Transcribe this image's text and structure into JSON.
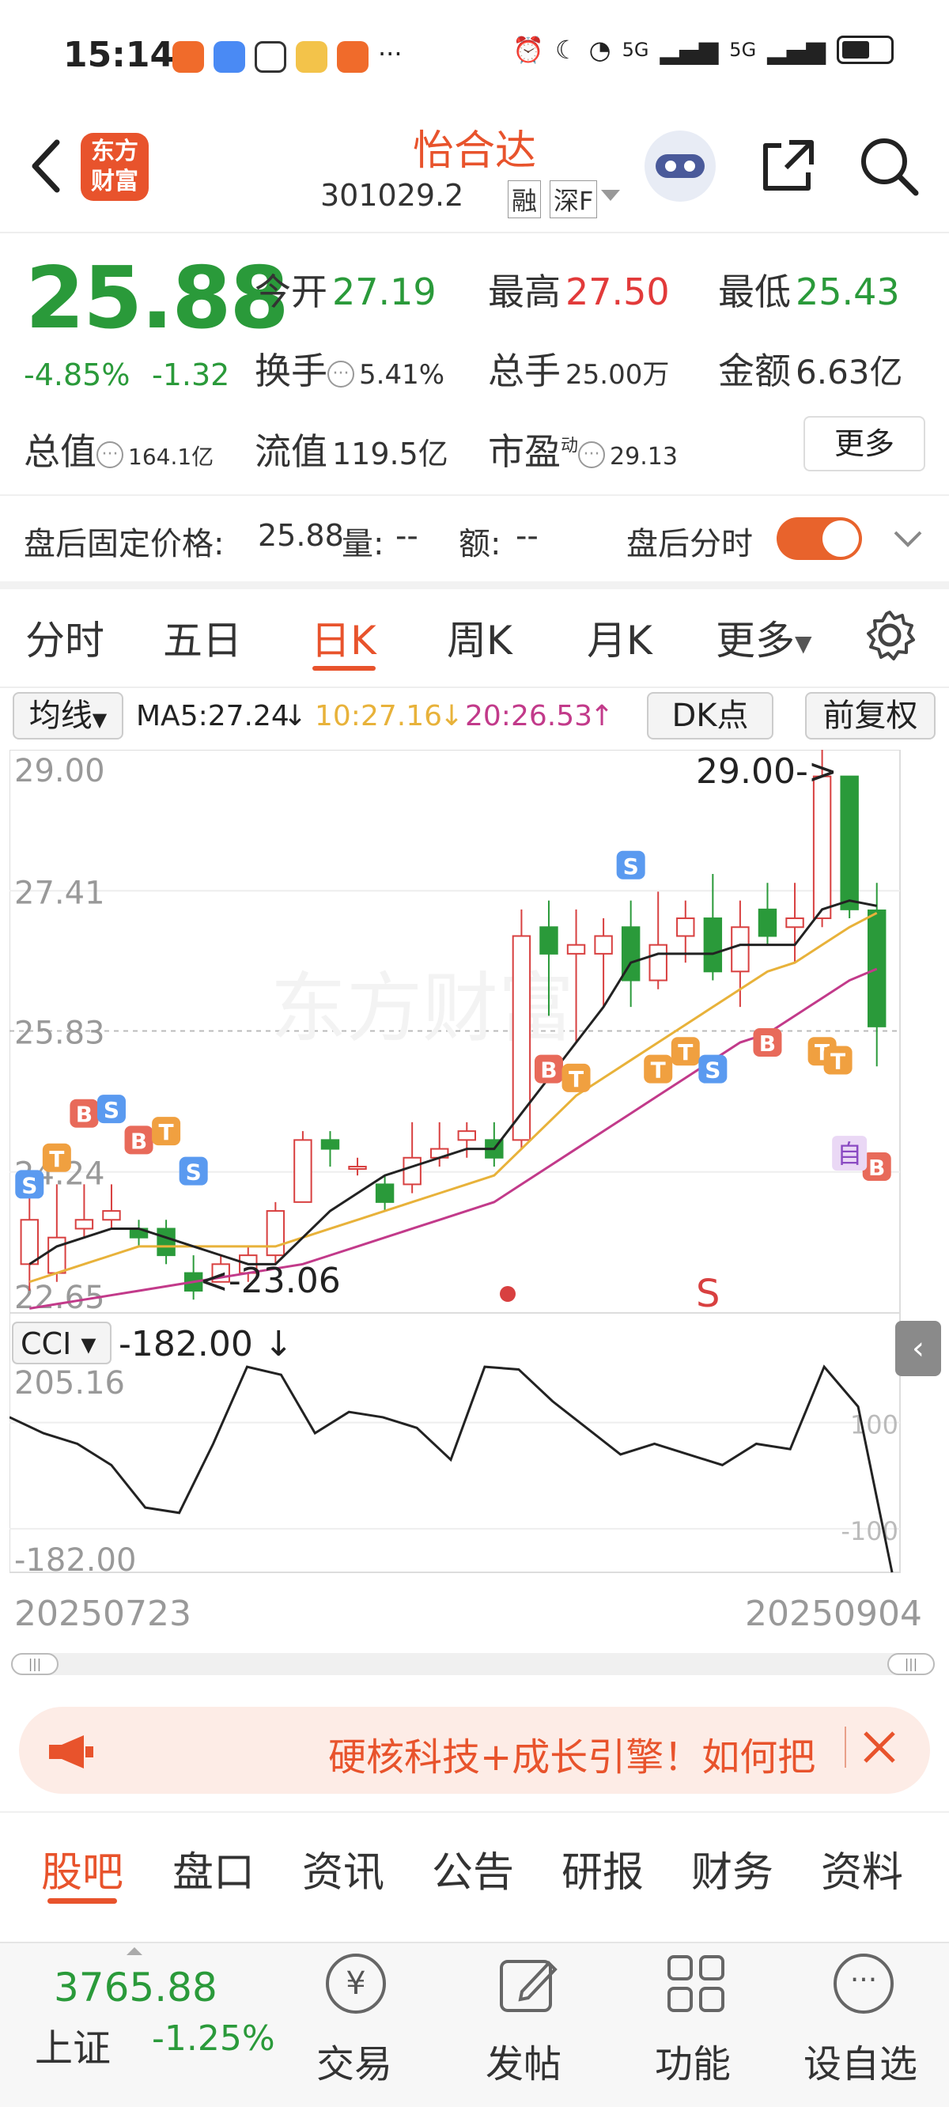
{
  "status_bar": {
    "time": "15:14",
    "signal1": "5G",
    "signal2": "5G"
  },
  "header": {
    "brand_line1": "东方",
    "brand_line2": "财富",
    "title": "怡合达",
    "code": "301029.2",
    "tag1": "融",
    "tag2": "深F"
  },
  "quote": {
    "price": "25.88",
    "change_pct": "-4.85%",
    "change": "-1.32",
    "open_label": "今开",
    "open": "27.19",
    "high_label": "最高",
    "high": "27.50",
    "low_label": "最低",
    "low": "25.43",
    "turnover_label": "换手",
    "turnover": "5.41%",
    "volume_label": "总手",
    "volume": "25.00万",
    "amount_label": "金额",
    "amount": "6.63亿",
    "mktcap_label": "总值",
    "mktcap": "164.1亿",
    "float_label": "流值",
    "float": "119.5亿",
    "pe_label": "市盈",
    "pe_sup": "动",
    "pe": "29.13",
    "more": "更多"
  },
  "after_hours": {
    "label": "盘后固定价格:",
    "price": "25.88",
    "vol_label": "量:",
    "vol": "--",
    "amt_label": "额:",
    "amt": "--",
    "toggle_label": "盘后分时"
  },
  "period_tabs": [
    {
      "label": "分时"
    },
    {
      "label": "五日"
    },
    {
      "label": "日K"
    },
    {
      "label": "周K"
    },
    {
      "label": "月K"
    },
    {
      "label": "更多"
    }
  ],
  "ma_bar": {
    "selector": "均线",
    "ma5": "MA5:27.24",
    "ma10": "10:27.16",
    "ma20": "20:26.53",
    "dk": "DK点",
    "adjust": "前复权"
  },
  "kline": {
    "y_labels": [
      "29.00",
      "27.41",
      "25.83",
      "24.24",
      "22.65"
    ],
    "max_note": "29.00->",
    "min_note": "<-23.06",
    "s_marker": "S",
    "signals": [
      "S",
      "T",
      "B",
      "S",
      "B",
      "T",
      "S",
      "B",
      "T",
      "S",
      "T",
      "T",
      "S",
      "B",
      "T",
      "T",
      "B"
    ],
    "self_tag": "自",
    "watermark": "东方财富"
  },
  "cci": {
    "selector": "CCI",
    "value": "-182.00",
    "y_labels": [
      "205.16",
      "-182.00"
    ],
    "ref_labels": [
      "100",
      "-100"
    ]
  },
  "date_range": {
    "start": "20250723",
    "end": "20250904"
  },
  "ad_banner": {
    "text": "硬核科技+成长引擎！如何把"
  },
  "bottom_tabs": [
    {
      "label": "股吧"
    },
    {
      "label": "盘口"
    },
    {
      "label": "资讯"
    },
    {
      "label": "公告"
    },
    {
      "label": "研报"
    },
    {
      "label": "财务"
    },
    {
      "label": "资料"
    }
  ],
  "index": {
    "value": "3765.88",
    "name": "上证",
    "change": "-1.25%"
  },
  "nav": [
    {
      "label": "交易"
    },
    {
      "label": "发帖"
    },
    {
      "label": "功能"
    },
    {
      "label": "设自选"
    }
  ],
  "chart_data": {
    "type": "candlestick",
    "x_range": [
      "20250723",
      "20250904"
    ],
    "ylim": [
      22.65,
      29.0
    ],
    "candles": [
      {
        "o": 23.2,
        "c": 23.7,
        "h": 24.0,
        "l": 22.9
      },
      {
        "o": 23.1,
        "c": 23.5,
        "h": 24.1,
        "l": 23.0
      },
      {
        "o": 23.6,
        "c": 23.7,
        "h": 24.1,
        "l": 23.5
      },
      {
        "o": 23.7,
        "c": 23.8,
        "h": 24.1,
        "l": 23.6
      },
      {
        "o": 23.6,
        "c": 23.5,
        "h": 23.7,
        "l": 23.4
      },
      {
        "o": 23.6,
        "c": 23.3,
        "h": 23.7,
        "l": 23.2
      },
      {
        "o": 23.1,
        "c": 22.9,
        "h": 23.3,
        "l": 22.8
      },
      {
        "o": 23.0,
        "c": 23.2,
        "h": 23.3,
        "l": 23.0
      },
      {
        "o": 23.1,
        "c": 23.3,
        "h": 23.4,
        "l": 23.0
      },
      {
        "o": 23.3,
        "c": 23.8,
        "h": 23.9,
        "l": 23.2
      },
      {
        "o": 23.9,
        "c": 24.6,
        "h": 24.7,
        "l": 23.9
      },
      {
        "o": 24.6,
        "c": 24.5,
        "h": 24.7,
        "l": 24.3
      },
      {
        "o": 24.3,
        "c": 24.3,
        "h": 24.4,
        "l": 24.2
      },
      {
        "o": 24.1,
        "c": 23.9,
        "h": 24.2,
        "l": 23.8
      },
      {
        "o": 24.1,
        "c": 24.4,
        "h": 24.8,
        "l": 24.0
      },
      {
        "o": 24.4,
        "c": 24.5,
        "h": 24.8,
        "l": 24.3
      },
      {
        "o": 24.6,
        "c": 24.7,
        "h": 24.8,
        "l": 24.4
      },
      {
        "o": 24.6,
        "c": 24.4,
        "h": 24.8,
        "l": 24.3
      },
      {
        "o": 24.6,
        "c": 26.9,
        "h": 27.2,
        "l": 24.5
      },
      {
        "o": 27.0,
        "c": 26.7,
        "h": 27.3,
        "l": 26.0
      },
      {
        "o": 26.7,
        "c": 26.8,
        "h": 27.2,
        "l": 25.7
      },
      {
        "o": 26.7,
        "c": 26.9,
        "h": 27.1,
        "l": 26.1
      },
      {
        "o": 27.0,
        "c": 26.4,
        "h": 27.3,
        "l": 26.1
      },
      {
        "o": 26.4,
        "c": 26.8,
        "h": 27.4,
        "l": 26.3
      },
      {
        "o": 26.9,
        "c": 27.1,
        "h": 27.3,
        "l": 26.6
      },
      {
        "o": 27.1,
        "c": 26.5,
        "h": 27.6,
        "l": 26.4
      },
      {
        "o": 26.5,
        "c": 27.0,
        "h": 27.3,
        "l": 26.1
      },
      {
        "o": 27.2,
        "c": 26.9,
        "h": 27.5,
        "l": 26.8
      },
      {
        "o": 27.0,
        "c": 27.1,
        "h": 27.5,
        "l": 26.6
      },
      {
        "o": 27.1,
        "c": 28.7,
        "h": 29.0,
        "l": 27.0
      },
      {
        "o": 28.7,
        "c": 27.2,
        "h": 28.7,
        "l": 27.1
      },
      {
        "o": 27.19,
        "c": 25.88,
        "h": 27.5,
        "l": 25.43
      }
    ],
    "ma5": [
      23.2,
      23.4,
      23.5,
      23.6,
      23.6,
      23.5,
      23.4,
      23.3,
      23.2,
      23.2,
      23.5,
      23.8,
      24.0,
      24.2,
      24.3,
      24.4,
      24.5,
      24.5,
      24.9,
      25.3,
      25.7,
      26.1,
      26.6,
      26.7,
      26.7,
      26.7,
      26.8,
      26.8,
      26.8,
      27.2,
      27.3,
      27.24
    ],
    "ma10": [
      23.0,
      23.1,
      23.2,
      23.3,
      23.4,
      23.4,
      23.4,
      23.4,
      23.4,
      23.4,
      23.5,
      23.6,
      23.7,
      23.8,
      23.9,
      24.0,
      24.1,
      24.2,
      24.5,
      24.8,
      25.1,
      25.3,
      25.5,
      25.7,
      25.9,
      26.1,
      26.3,
      26.5,
      26.6,
      26.8,
      27.0,
      27.16
    ],
    "ma20": [
      22.7,
      22.75,
      22.8,
      22.85,
      22.9,
      22.95,
      23.0,
      23.05,
      23.1,
      23.15,
      23.2,
      23.3,
      23.4,
      23.5,
      23.6,
      23.7,
      23.8,
      23.9,
      24.1,
      24.3,
      24.5,
      24.7,
      24.9,
      25.1,
      25.3,
      25.5,
      25.7,
      25.8,
      26.0,
      26.2,
      26.4,
      26.53
    ],
    "cci": [
      110,
      80,
      60,
      20,
      -60,
      -70,
      60,
      205,
      190,
      80,
      120,
      110,
      90,
      30,
      205,
      200,
      140,
      90,
      40,
      60,
      40,
      20,
      60,
      50,
      205,
      130,
      -182
    ]
  }
}
